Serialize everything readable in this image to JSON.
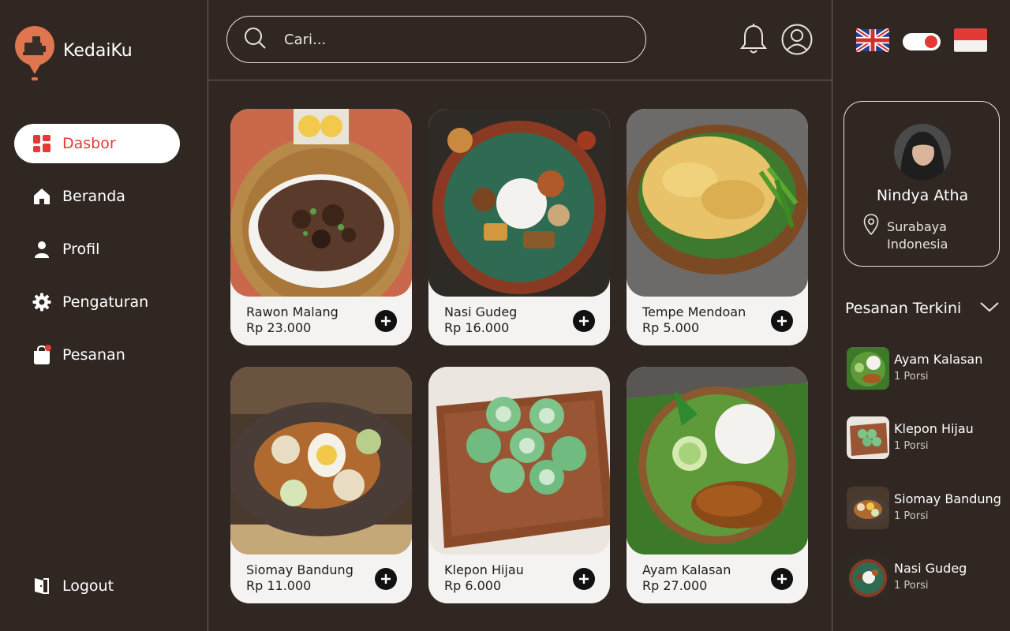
{
  "brand": {
    "name": "KedaiKu",
    "accent": "#e0764f"
  },
  "nav": {
    "items": [
      {
        "label": "Dasbor",
        "icon": "dashboard-icon",
        "active": true
      },
      {
        "label": "Beranda",
        "icon": "home-icon"
      },
      {
        "label": "Profil",
        "icon": "person-icon"
      },
      {
        "label": "Pengaturan",
        "icon": "gear-icon"
      },
      {
        "label": "Pesanan",
        "icon": "shopping-bag-icon"
      }
    ],
    "logout": "Logout"
  },
  "search": {
    "placeholder": "Cari..."
  },
  "menu": [
    {
      "name": "Rawon Malang",
      "price": "Rp 23.000"
    },
    {
      "name": "Nasi Gudeg",
      "price": "Rp 16.000"
    },
    {
      "name": "Tempe Mendoan",
      "price": "Rp 5.000"
    },
    {
      "name": "Siomay Bandung",
      "price": "Rp 11.000"
    },
    {
      "name": "Klepon Hijau",
      "price": "Rp 6.000"
    },
    {
      "name": "Ayam Kalasan",
      "price": "Rp 27.000"
    }
  ],
  "profile": {
    "name": "Nindya Atha",
    "city": "Surabaya",
    "country": "Indonesia"
  },
  "recent": {
    "title": "Pesanan Terkini",
    "items": [
      {
        "name": "Ayam Kalasan",
        "qty": "1 Porsi"
      },
      {
        "name": "Klepon Hijau",
        "qty": "1 Porsi"
      },
      {
        "name": "Siomay Bandung",
        "qty": "1 Porsi"
      },
      {
        "name": "Nasi Gudeg",
        "qty": "1 Porsi"
      }
    ]
  },
  "colors": {
    "background": "#302723",
    "active_text": "#e53935",
    "card": "#f5f3f1"
  }
}
